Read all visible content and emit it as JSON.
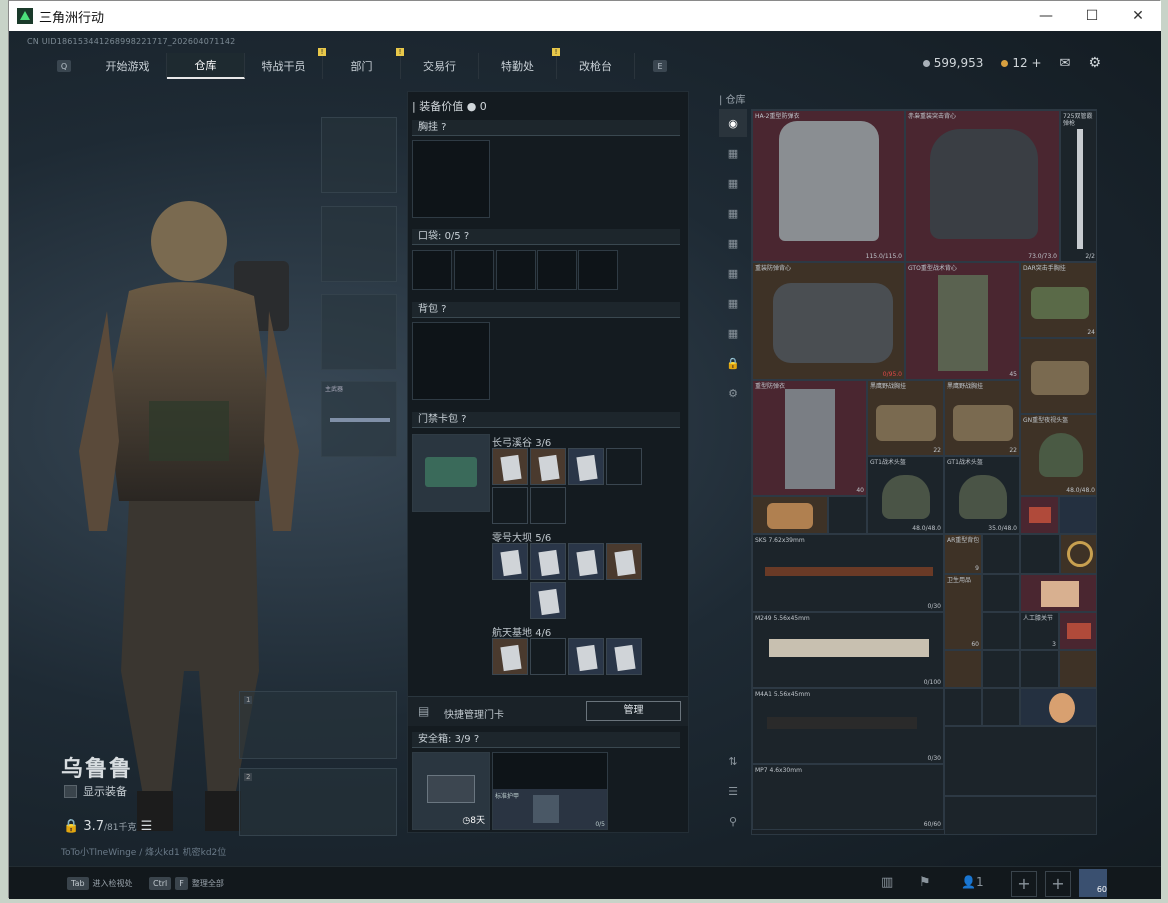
{
  "window": {
    "title": "三角洲行动",
    "minimize": "—",
    "maximize": "☐",
    "close": "✕"
  },
  "uid": "CN UID18615344126899822171​7_202604071142",
  "nav": {
    "key_left": "Q",
    "key_right": "E",
    "tabs": [
      {
        "label": "开始游戏",
        "badge": ""
      },
      {
        "label": "仓库",
        "badge": ""
      },
      {
        "label": "特战干员",
        "badge": "!"
      },
      {
        "label": "部门",
        "badge": "!"
      },
      {
        "label": "交易行",
        "badge": ""
      },
      {
        "label": "特勤处",
        "badge": "!"
      },
      {
        "label": "改枪台",
        "badge": ""
      }
    ]
  },
  "currency": {
    "hafcoin": "599,953",
    "tickets": "12",
    "plus": "+"
  },
  "character": {
    "name": "乌鲁鲁",
    "show_equipment": "显示装备",
    "weight": "3.7",
    "weight_max": "/81千克",
    "link": "ToTo小TlneWinge / 烽火kd1 机密kd2位"
  },
  "slots": {
    "melee_label": "主武器",
    "w1": "1",
    "w2": "2"
  },
  "mid": {
    "equip_value_label": "装备价值",
    "equip_value": "0",
    "chest": "胸挂",
    "pocket": "口袋:",
    "pocket_count": "0/5",
    "backpack": "背包",
    "keycard": "门禁卡包",
    "key_sections": [
      {
        "name": "长弓溪谷",
        "count": "3/6"
      },
      {
        "name": "零号大坝",
        "count": "5/6"
      },
      {
        "name": "航天基地",
        "count": "4/6"
      }
    ],
    "quick_manage": "快捷管理门卡",
    "manage_btn": "管理",
    "safebox": "安全箱:",
    "safebox_count": "3/9",
    "safebox_time": "8天",
    "safebox_item": "标准护甲",
    "safebox_item_count": "0/5"
  },
  "stash": {
    "title": "仓库",
    "items": [
      {
        "name": "HA-2重型防弹衣",
        "count": "115.0/115.0",
        "red": false
      },
      {
        "name": "赤枭重装突击背心",
        "count": "73.0/73.0",
        "red": false
      },
      {
        "name": "725双管霰弹枪",
        "count": "2/2",
        "red": false
      },
      {
        "name": "重装防弹背心",
        "count": "0/95.0",
        "red": true
      },
      {
        "name": "GTO重型战术背心",
        "count": "45",
        "red": false
      },
      {
        "name": "DAR突击手胸挂",
        "count": "24",
        "red": false
      },
      {
        "name": "重型防弹衣",
        "count": "40",
        "red": false
      },
      {
        "name": "黑鹰野战胸挂",
        "count": "22",
        "red": false
      },
      {
        "name": "黑鹰野战胸挂",
        "count": "22",
        "red": false
      },
      {
        "name": "GT1战术头盔",
        "count": "48.0/48.0",
        "red": false
      },
      {
        "name": "GT1战术头盔",
        "count": "35.0/48.0",
        "red": false
      },
      {
        "name": "GN重型夜视头盔",
        "count": "48.0/48.0",
        "red": false
      },
      {
        "name": "SKS 7.62x39mm",
        "count": "0/30",
        "red": false
      },
      {
        "name": "M249 5.56x45mm",
        "count": "0/100",
        "red": false
      },
      {
        "name": "M4A1 5.56x45mm",
        "count": "0/30",
        "red": false
      },
      {
        "name": "MP7 4.6x30mm",
        "count": "60/60",
        "red": false
      },
      {
        "name": "AR重型背包",
        "count": "9",
        "red": false
      },
      {
        "name": "卫生用品",
        "count": "60",
        "red": false
      },
      {
        "name": "人工膝关节",
        "count": "3",
        "red": false
      }
    ]
  },
  "bottom": {
    "tab_key": "Tab",
    "tab_label": "进入检视处",
    "ctrl_key": "Ctrl",
    "f_key": "F",
    "f_label": "整理全部",
    "squad": "1",
    "ammo": "60"
  },
  "colors": {
    "accent": "#e8c84a",
    "dark": "#0f1418",
    "red_item": "#4a2630"
  }
}
